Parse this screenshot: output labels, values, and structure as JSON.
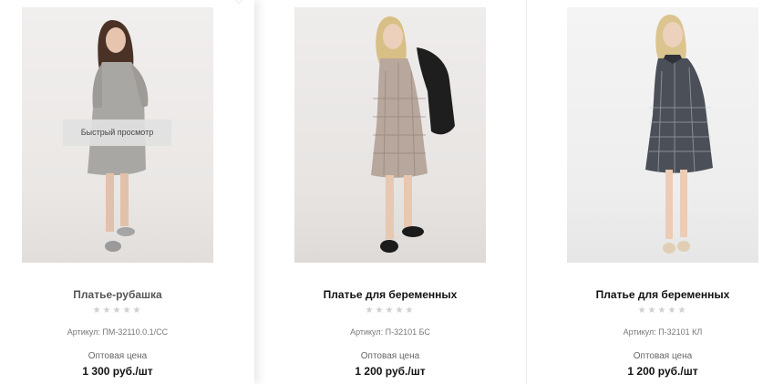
{
  "products": [
    {
      "title": "Платье-рубашка",
      "sku": "Артикул: ПМ-32110.0.1/СС",
      "rating_stars": "★★★★★",
      "price_label": "Оптовая цена",
      "price": "1 300 руб./шт",
      "quick_view_label": "Быстрый просмотр",
      "image_icon": "dress-photo-icon",
      "wishlist_icon": "heart-icon"
    },
    {
      "title": "Платье для беременных",
      "sku": "Артикул: П-32101 БС",
      "rating_stars": "★★★★★",
      "price_label": "Оптовая цена",
      "price": "1 200 руб./шт",
      "image_icon": "dress-photo-icon"
    },
    {
      "title": "Платье для беременных",
      "sku": "Артикул: П-32101 КЛ",
      "rating_stars": "★★★★★",
      "price_label": "Оптовая цена",
      "price": "1 200 руб./шт",
      "image_icon": "dress-photo-icon"
    }
  ],
  "colors": {
    "title": "#111111",
    "muted_text": "#777777",
    "star_empty": "#cfcfcf",
    "quick_view_bg": "#e1e1e1"
  }
}
